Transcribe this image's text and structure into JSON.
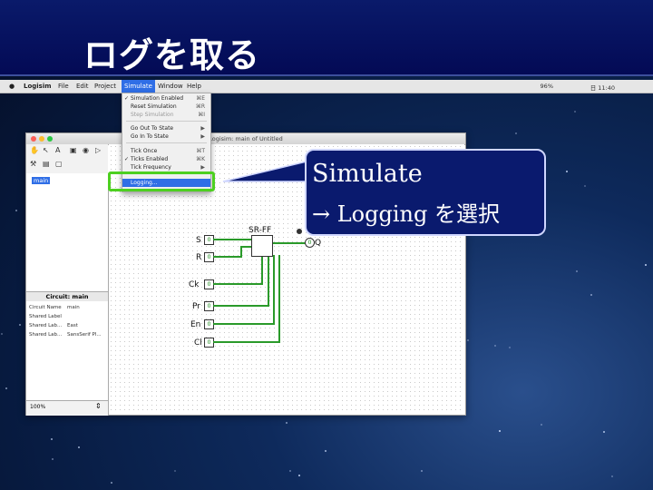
{
  "slide": {
    "title": "ログを取る"
  },
  "menubar": {
    "app": "Logisim",
    "items": [
      "File",
      "Edit",
      "Project",
      "Simulate",
      "Window",
      "Help"
    ],
    "active": "Simulate",
    "right": {
      "battery": "96%",
      "clock": "日 11:40"
    }
  },
  "window": {
    "title": "Logisim: main of Untitled"
  },
  "explorer": {
    "selected": "main"
  },
  "properties": {
    "header": "Circuit: main",
    "rows": [
      {
        "k": "Circuit Name",
        "v": "main"
      },
      {
        "k": "Shared Label",
        "v": ""
      },
      {
        "k": "Shared Lab...",
        "v": "East"
      },
      {
        "k": "Shared Lab...",
        "v": "SansSerif Pl..."
      }
    ]
  },
  "zoom": {
    "value": "100%"
  },
  "circuit": {
    "pins": [
      "S",
      "R",
      "Ck",
      "Pr",
      "En",
      "Cl"
    ],
    "ff_label": "SR-FF",
    "output": "Q",
    "pin_values": [
      "0",
      "0",
      "0",
      "0",
      "0",
      "0"
    ],
    "output_value": "0"
  },
  "simulate_menu": {
    "items": [
      {
        "label": "Simulation Enabled",
        "shortcut": "⌘E",
        "check": "✓",
        "state": "normal"
      },
      {
        "label": "Reset Simulation",
        "shortcut": "⌘R",
        "check": "",
        "state": "normal"
      },
      {
        "label": "Step Simulation",
        "shortcut": "⌘I",
        "check": "",
        "state": "disabled"
      },
      {
        "label": "Go Out To State",
        "shortcut": "▶",
        "check": "",
        "state": "normal"
      },
      {
        "label": "Go In To State",
        "shortcut": "▶",
        "check": "",
        "state": "normal"
      },
      {
        "label": "Tick Once",
        "shortcut": "⌘T",
        "check": "",
        "state": "normal"
      },
      {
        "label": "Ticks Enabled",
        "shortcut": "⌘K",
        "check": "✓",
        "state": "normal"
      },
      {
        "label": "Tick Frequency",
        "shortcut": "▶",
        "check": "",
        "state": "normal"
      },
      {
        "label": "Logging...",
        "shortcut": "",
        "check": "",
        "state": "highlighted"
      }
    ]
  },
  "callout": {
    "line1": "Simulate",
    "line2": "→ Logging を選択"
  },
  "colors": {
    "highlight": "#4dd020",
    "callout_bg": "#0a1a6e",
    "menu_highlight": "#2f6ee6",
    "wire": "#2a9a2a"
  }
}
